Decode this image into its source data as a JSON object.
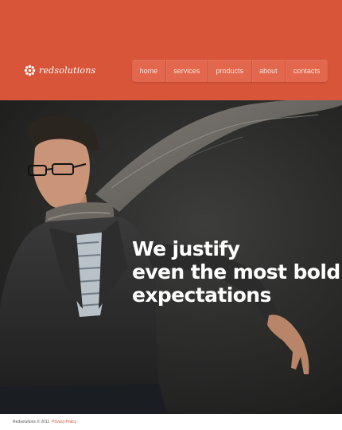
{
  "header": {
    "logo_text": "redsolutions",
    "nav": [
      {
        "label": "home"
      },
      {
        "label": "services"
      },
      {
        "label": "products"
      },
      {
        "label": "about"
      },
      {
        "label": "contacts"
      }
    ]
  },
  "hero": {
    "heading_lines": [
      "We justify",
      "even the most bold",
      "expectations"
    ]
  },
  "footer": {
    "copyright": "Redsolutions © 2011",
    "privacy_link": "Privacy Policy"
  },
  "colors": {
    "accent": "#d9553a",
    "nav_background": "#e2674c",
    "hero_background": "#2a2a29",
    "heading_text": "#ffffff"
  },
  "icons": {
    "logo": "flower-icon"
  }
}
